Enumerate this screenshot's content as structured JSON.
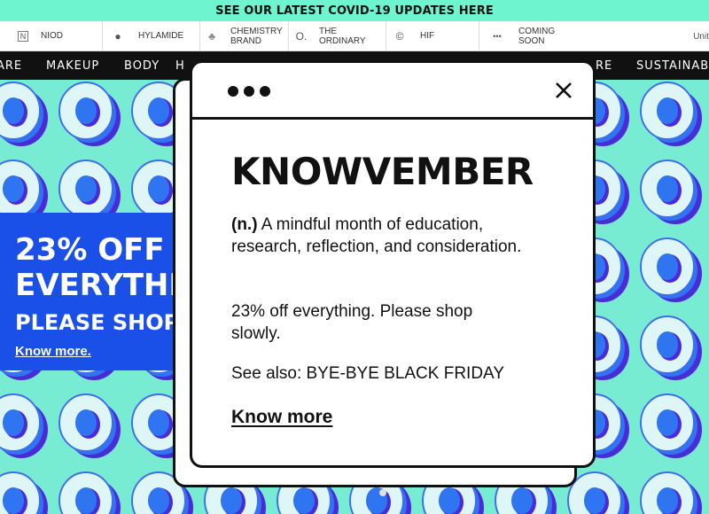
{
  "announcement": "SEE OUR LATEST COVID-19 UPDATES HERE",
  "brands": [
    {
      "icon": "niod-icon",
      "glyph": "N",
      "label": "NIOD"
    },
    {
      "icon": "hylamide-icon",
      "glyph": "●",
      "label": "HYLAMIDE"
    },
    {
      "icon": "chemistry-brand-icon",
      "glyph": "♣",
      "label": "CHEMISTRY BRAND"
    },
    {
      "icon": "the-ordinary-icon",
      "glyph": "O.",
      "label": "THE ORDINARY"
    },
    {
      "icon": "hif-icon",
      "glyph": "©",
      "label": "HIF"
    },
    {
      "icon": "coming-soon-icon",
      "glyph": "•••",
      "label": "COMING SOON"
    }
  ],
  "units_text": "Unit",
  "nav": [
    "ARE",
    "MAKEUP",
    "BODY",
    "H",
    "RE",
    "SUSTAINAB"
  ],
  "promo": {
    "line1": "23% OFF",
    "line2": "EVERYTHI",
    "line3": "PLEASE SHOP",
    "link": "Know more."
  },
  "modal": {
    "title": "KNOWVEMBER",
    "def_pos": "(n.)",
    "def_text": " A mindful month of education, research, reflection, and consideration.",
    "offer": "23% off everything. Please shop slowly.",
    "see_also": "See also: BYE-BYE BLACK FRIDAY",
    "cta": "Know more"
  }
}
